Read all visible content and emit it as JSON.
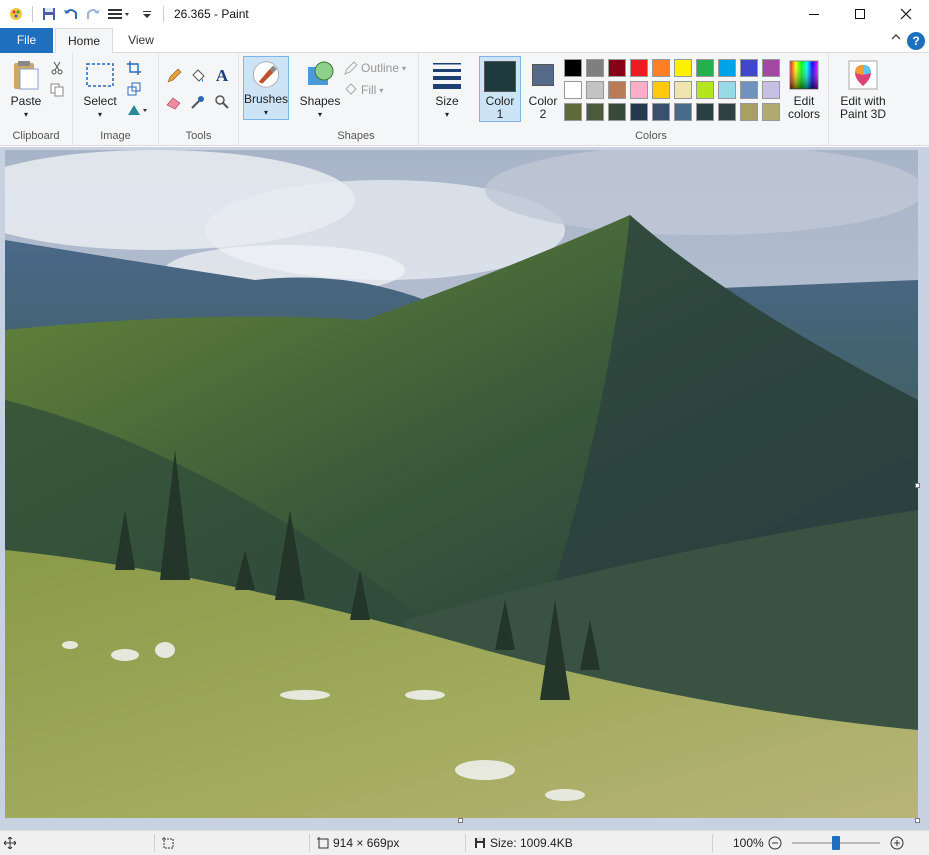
{
  "window": {
    "title": "26.365 - Paint",
    "minimize_icon": "minimize-icon",
    "maximize_icon": "maximize-icon",
    "close_icon": "close-icon"
  },
  "tabs": [
    {
      "label": "File"
    },
    {
      "label": "Home"
    },
    {
      "label": "View"
    }
  ],
  "ribbon": {
    "clipboard": {
      "paste_label": "Paste",
      "group_label": "Clipboard"
    },
    "image": {
      "select_label": "Select",
      "group_label": "Image"
    },
    "tools": {
      "group_label": "Tools"
    },
    "brushes": {
      "label": "Brushes"
    },
    "shapes": {
      "label": "Shapes",
      "outline_label": "Outline",
      "fill_label": "Fill",
      "group_label": "Shapes"
    },
    "size": {
      "label": "Size"
    },
    "colors": {
      "color1_label": "Color",
      "color1_num": "1",
      "color2_label": "Color",
      "color2_num": "2",
      "edit_label_1": "Edit",
      "edit_label_2": "colors",
      "paint3d_label_1": "Edit with",
      "paint3d_label_2": "Paint 3D",
      "group_label": "Colors",
      "color1_value": "#1f3a3f",
      "color2_value": "#556a88",
      "palette": [
        "#000000",
        "#7f7f7f",
        "#880015",
        "#ed1c24",
        "#ff7f27",
        "#fff200",
        "#22b14c",
        "#00a2e8",
        "#3f48cc",
        "#a349a4",
        "#ffffff",
        "#c3c3c3",
        "#b97a57",
        "#ffaec9",
        "#ffc90e",
        "#efe4b0",
        "#b5e61d",
        "#99d9ea",
        "#7092be",
        "#c8bfe7",
        "#5f6a3a",
        "#4a5a3a",
        "#3a4a3a",
        "#243a52",
        "#3b4f6e",
        "#4a6a8a",
        "#2a3f3f",
        "#2f4040",
        "#a8a060",
        "#b0aa70"
      ]
    }
  },
  "status": {
    "dimensions": "914 × 669px",
    "size": "Size: 1009.4KB",
    "zoom": "100%",
    "zoom_level_percent": 100
  }
}
